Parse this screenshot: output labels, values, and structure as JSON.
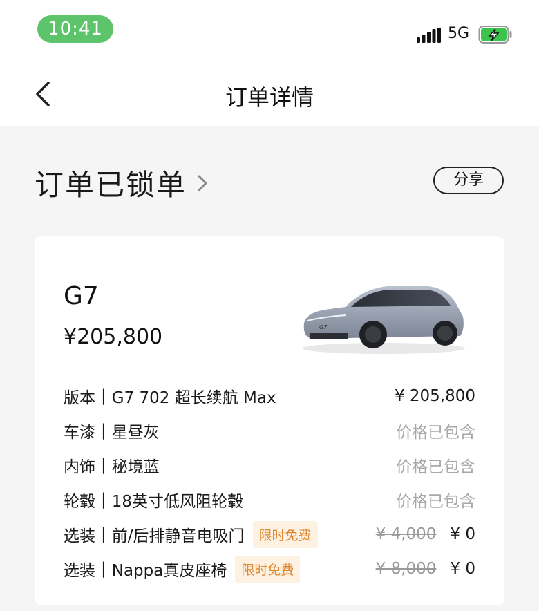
{
  "status_bar": {
    "time": "10:41",
    "network": "5G",
    "signal_icon": "signal-bars-icon",
    "battery_icon": "battery-charging-icon",
    "time_pill_color": "#5ec46b",
    "battery_color": "#3cc34c"
  },
  "nav": {
    "back_icon": "chevron-left-icon",
    "title": "订单详情"
  },
  "order_status": {
    "text": "订单已锁单",
    "chevron_icon": "chevron-right-icon",
    "share_label": "分享"
  },
  "car": {
    "model": "G7",
    "price": "¥205,800",
    "image_desc": "car-image"
  },
  "specs": [
    {
      "label": "版本",
      "value": "G7 702 超长续航 Max",
      "price": "¥ 205,800"
    },
    {
      "label": "车漆",
      "value": "星昼灰",
      "included": "价格已包含"
    },
    {
      "label": "内饰",
      "value": "秘境蓝",
      "included": "价格已包含"
    },
    {
      "label": "轮毂",
      "value": "18英寸低风阻轮毂",
      "included": "价格已包含"
    },
    {
      "label": "选装",
      "value": "前/后排静音电吸门",
      "tag": "限时免费",
      "original_price": "¥ 4,000",
      "price": "¥ 0"
    },
    {
      "label": "选装",
      "value": "Nappa真皮座椅",
      "tag": "限时免费",
      "original_price": "¥ 8,000",
      "price": "¥ 0"
    }
  ],
  "colors": {
    "promo_text": "#e0862d",
    "promo_bg": "#fdf1e2",
    "muted": "#a8a8a8"
  }
}
